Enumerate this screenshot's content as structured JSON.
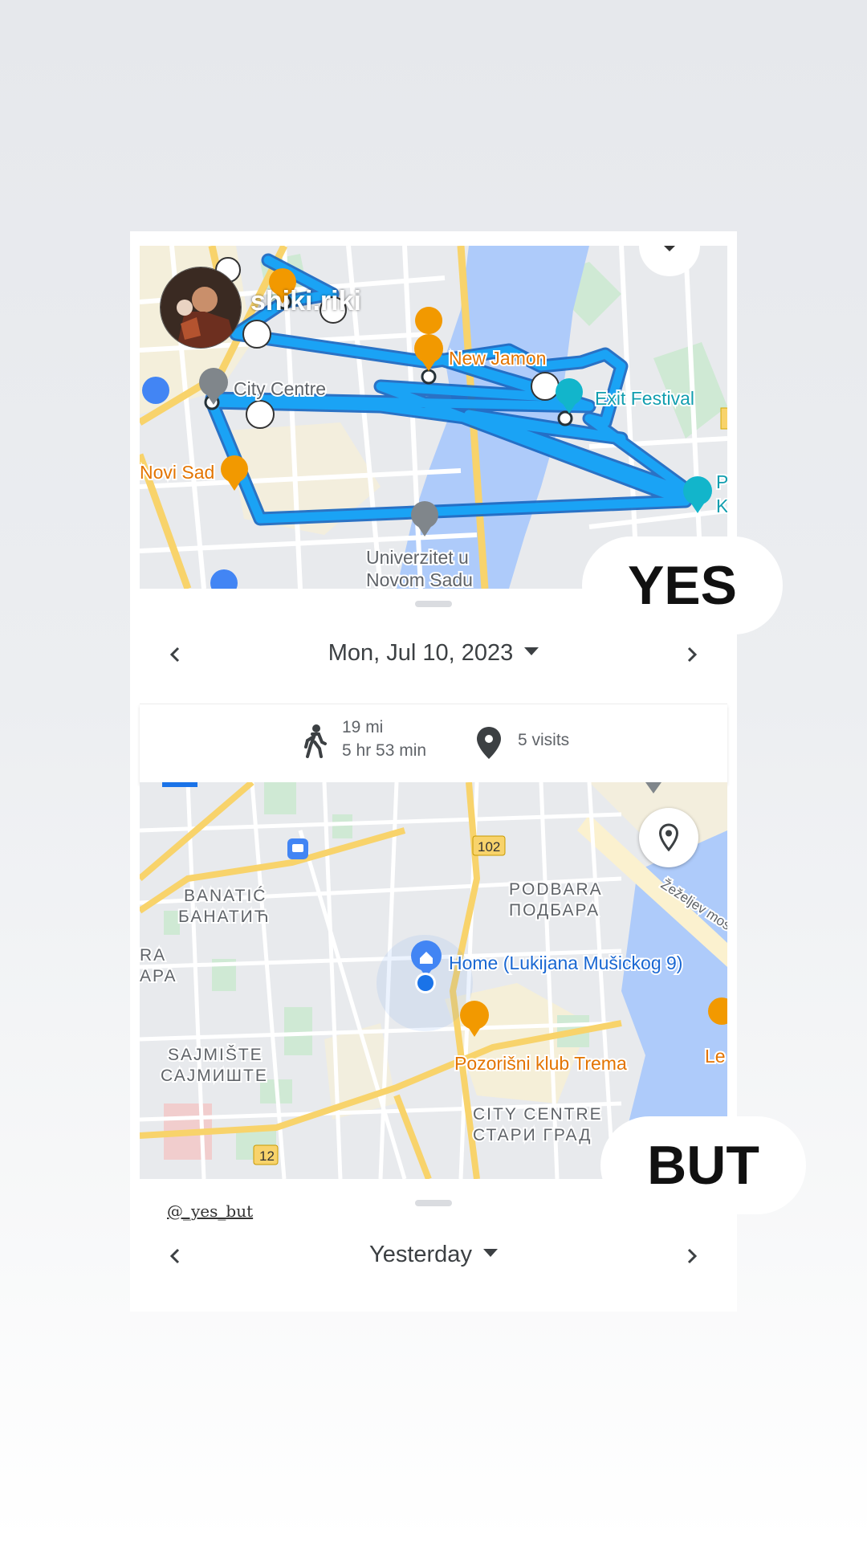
{
  "top_panel": {
    "username": "shiki.riki",
    "date_label": "Mon, Jul 10, 2023",
    "stats": {
      "distance": "19 mi",
      "duration": "5 hr 53 min",
      "visits": "5 visits"
    },
    "map_labels": {
      "new_jamon": "New Jamon",
      "city_centre": "City Centre",
      "exit_festival": "Exit Festival",
      "novi_sad": "Novi Sad",
      "univerzitet_1": "Univerzitet u",
      "univerzitet_2": "Novom Sadu",
      "p_cut": "P",
      "k_cut": "K"
    },
    "route_color": "#1a9cf0"
  },
  "bottom_panel": {
    "date_label": "Yesterday",
    "map_labels": {
      "banatic_lat": "BANATIĆ",
      "banatic_cyr": "БАНАТИЋ",
      "podbara_lat": "PODBARA",
      "podbara_cyr": "ПОДБАРА",
      "ra": "RA",
      "apa": "APA",
      "home": "Home (Lukijana Mušickog 9)",
      "sajmiste_lat": "SAJMIŠTE",
      "sajmiste_cyr": "САЈМИШТЕ",
      "pozorisni": "Pozorišni klub Trema",
      "city_centre_lat": "CITY CENTRE",
      "city_centre_cyr": "СТАРИ ГРАД",
      "zezeljev": "Žeželjev most",
      "le": "Le",
      "road_102": "102",
      "road_12": "12"
    }
  },
  "captions": {
    "yes": "YES",
    "but": "BUT",
    "handle": "@_yes_but"
  },
  "colors": {
    "accent": "#1a73e8",
    "food_pin": "#f29900",
    "attraction_pin": "#12b5cb",
    "river": "#aecbfa"
  }
}
